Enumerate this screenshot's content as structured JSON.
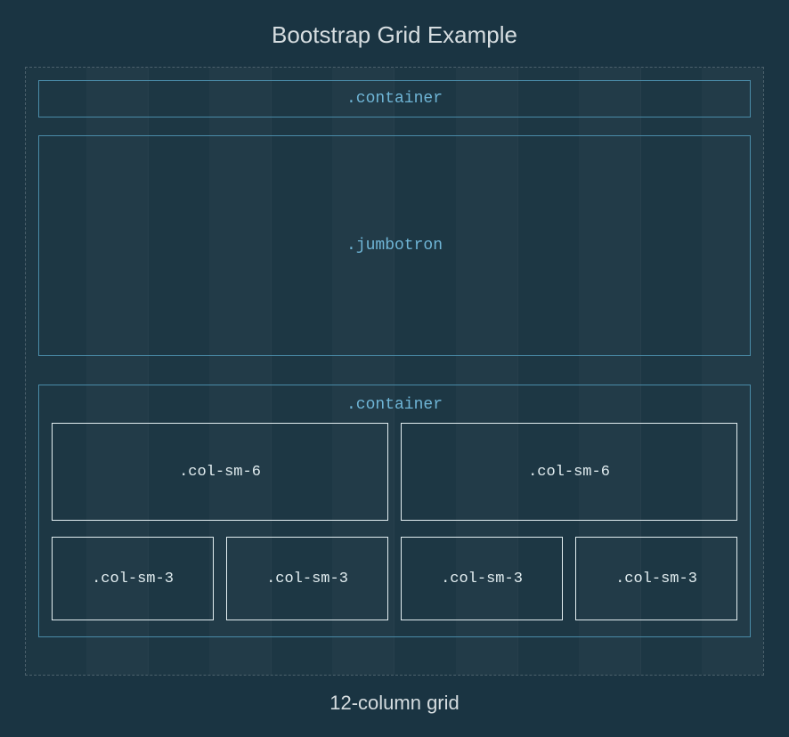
{
  "title": "Bootstrap Grid Example",
  "footer": "12-column grid",
  "containerTop": {
    "label": ".container"
  },
  "jumbotron": {
    "label": ".jumbotron"
  },
  "containerBottom": {
    "label": ".container",
    "row1": [
      {
        "label": ".col-sm-6"
      },
      {
        "label": ".col-sm-6"
      }
    ],
    "row2": [
      {
        "label": ".col-sm-3"
      },
      {
        "label": ".col-sm-3"
      },
      {
        "label": ".col-sm-3"
      },
      {
        "label": ".col-sm-3"
      }
    ]
  }
}
